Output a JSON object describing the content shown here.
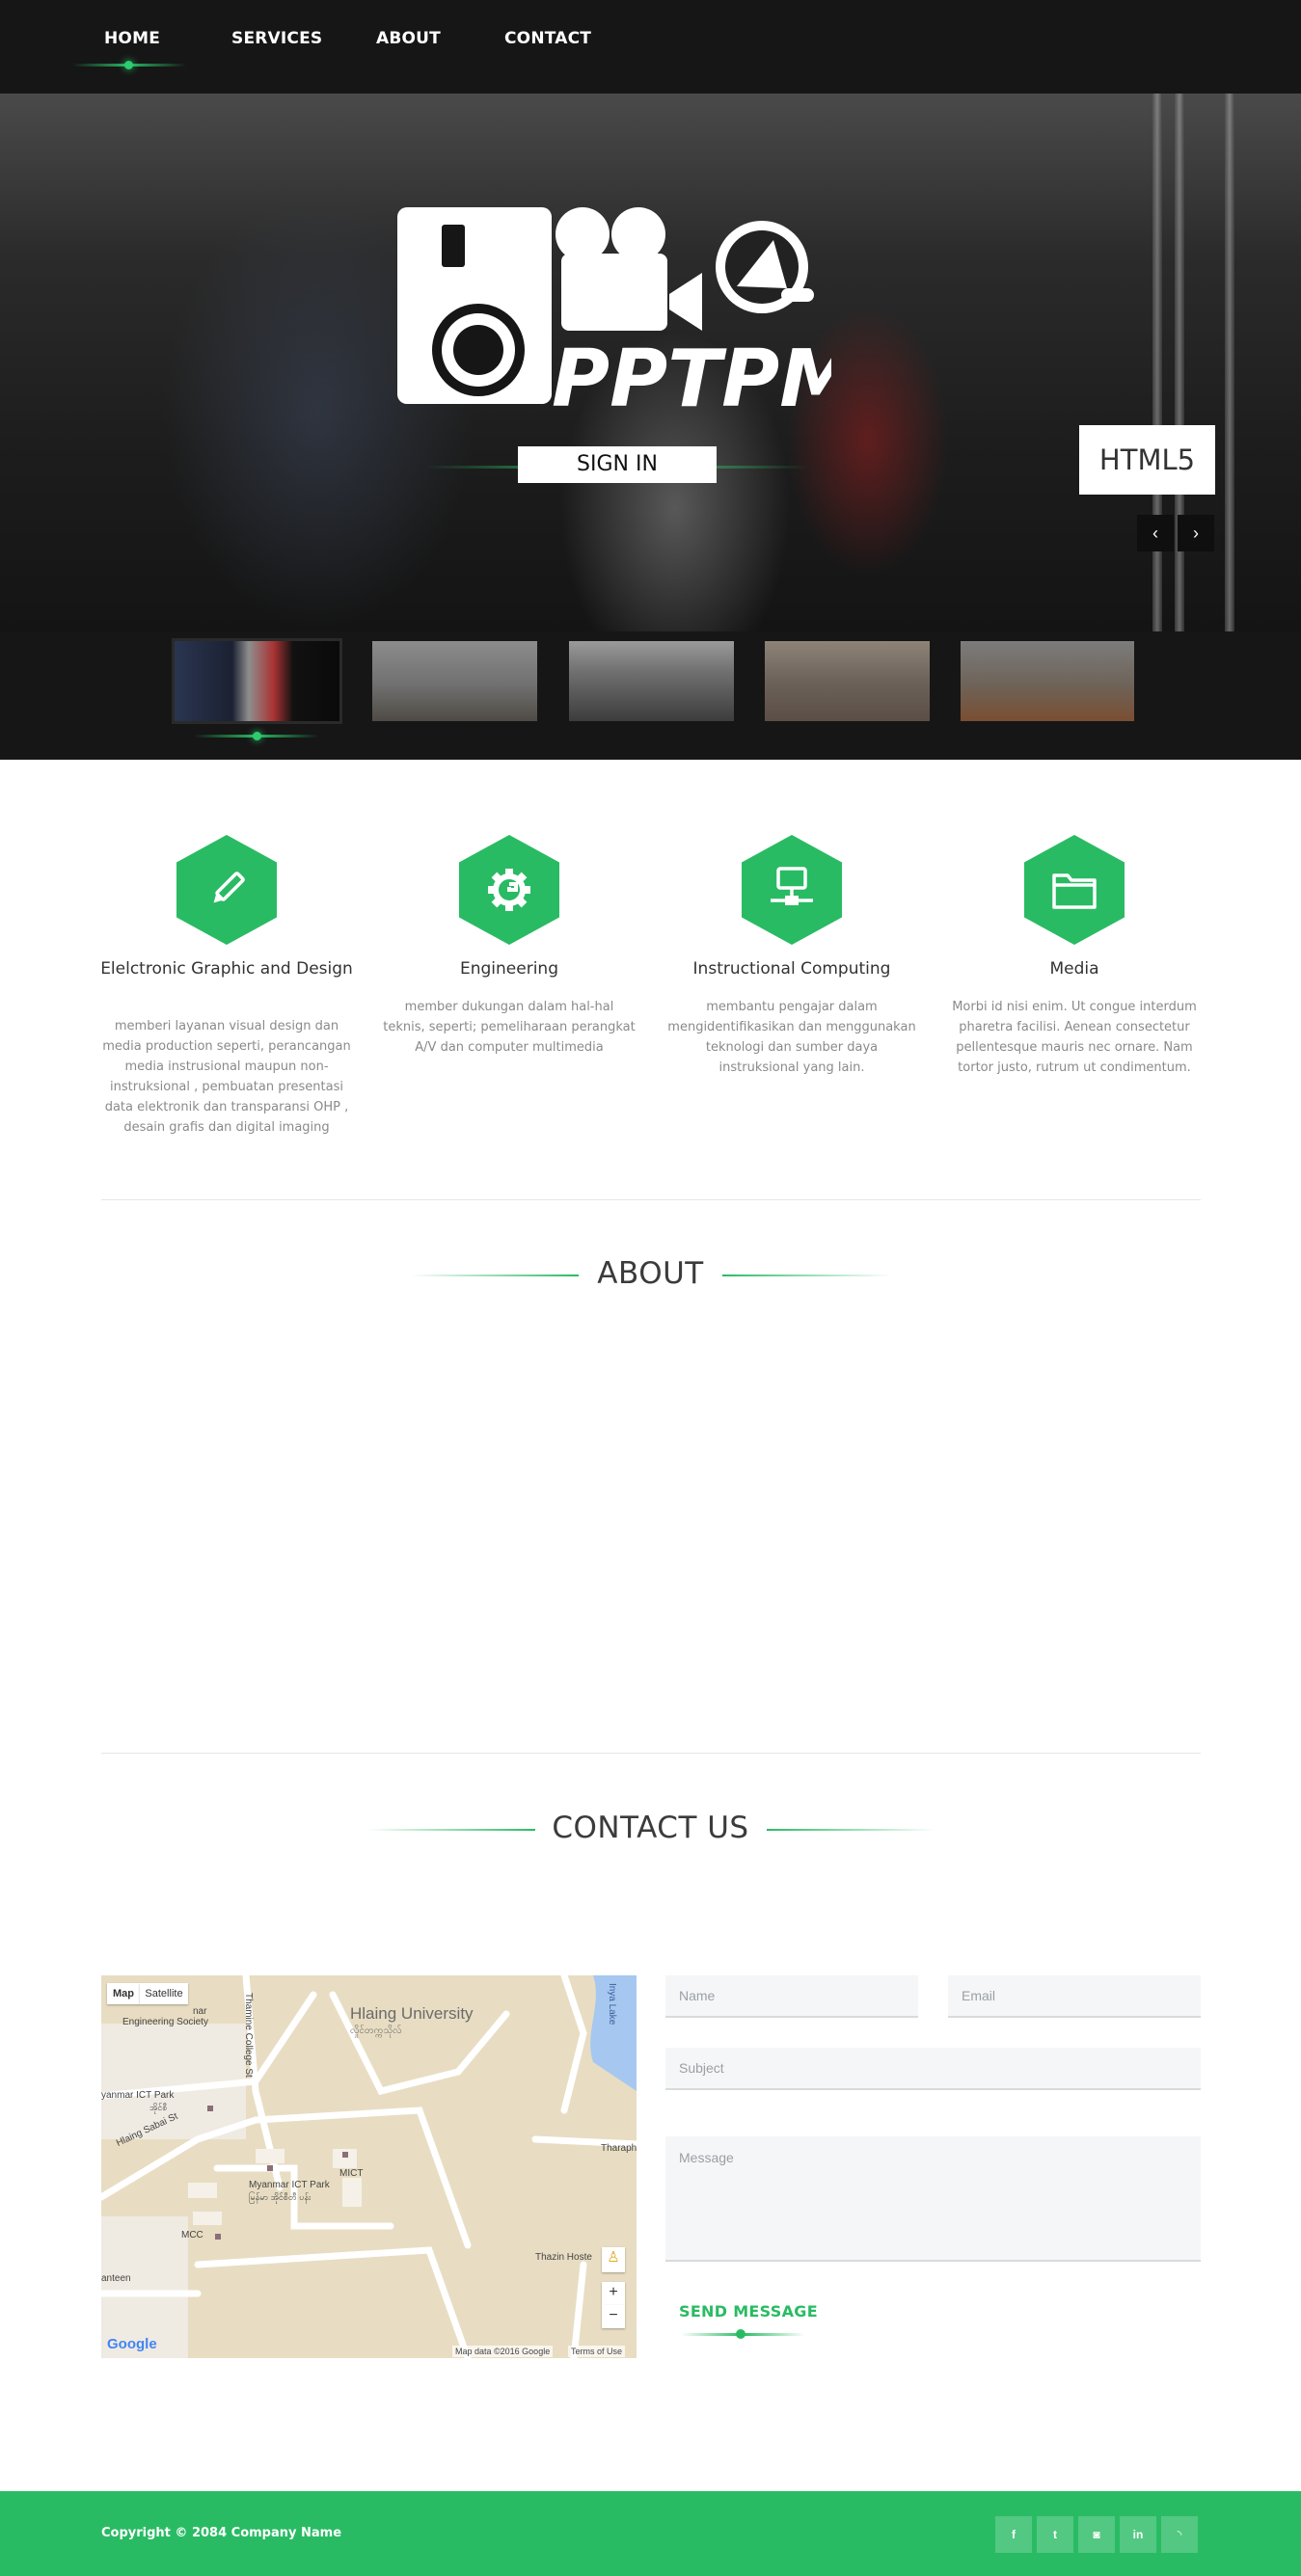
{
  "nav": {
    "items": [
      {
        "label": "HOME",
        "active": true
      },
      {
        "label": "SERVICES"
      },
      {
        "label": "ABOUT"
      },
      {
        "label": "CONTACT"
      }
    ],
    "accent": "#29bb63"
  },
  "hero": {
    "logo_text": "PPTPM",
    "sign_in_label": "SIGN IN",
    "badge_text": "HTML5",
    "prev_icon": "chevron-left-icon",
    "next_icon": "chevron-right-icon"
  },
  "services": [
    {
      "icon": "pencil-icon",
      "title": "Elelctronic Graphic and Design",
      "desc": "memberi layanan visual design dan media production seperti, perancangan media instrusional maupun non-instruksional , pembuatan presentasi data elektronik dan transparansi OHP , desain grafis dan digital imaging"
    },
    {
      "icon": "gear-icon",
      "title": "Engineering",
      "desc": "member dukungan dalam hal-hal teknis, seperti; pemeliharaan perangkat A/V dan computer multimedia"
    },
    {
      "icon": "network-icon",
      "title": "Instructional Computing",
      "desc": "membantu pengajar dalam mengidentifikasikan dan menggunakan teknologi dan sumber daya instruksional yang lain."
    },
    {
      "icon": "folder-icon",
      "title": "Media",
      "desc": "Morbi id nisi enim. Ut congue interdum pharetra facilisi. Aenean consectetur pellentesque mauris nec ornare. Nam tortor justo, rutrum ut condimentum."
    }
  ],
  "about": {
    "title": "ABOUT"
  },
  "contact": {
    "title": "CONTACT US",
    "map": {
      "map_label": "Map",
      "satellite_label": "Satellite",
      "place_university": "Hlaing University",
      "place_university_local": "လှိုင်တက္ကသိုလ်",
      "place_ict_park": "Myanmar ICT Park",
      "place_ict_park_local": "မြန်မာ အိုင်စီတီ ပန်း",
      "place_mict": "MICT",
      "place_mcc": "MCC",
      "place_eng_society": "Engineering Society",
      "place_nar": "nar",
      "place_ict_park_left": "yanmar ICT Park",
      "place_ict_park_left_local": "အိုင်စီ",
      "street_thamine": "Thamine College St",
      "street_sabai": "Hlaing Sabai St",
      "place_inya": "Inya Lake",
      "place_tharaphu": "Tharaph",
      "place_thazin": "Thazin Hoste",
      "place_canteen": "anteen",
      "zoom_in": "+",
      "zoom_out": "−",
      "attribution": "Map data ©2016 Google",
      "terms": "Terms of Use",
      "google": "Google"
    },
    "form": {
      "name_placeholder": "Name",
      "email_placeholder": "Email",
      "subject_placeholder": "Subject",
      "message_placeholder": "Message",
      "send_label": "SEND MESSAGE"
    }
  },
  "footer": {
    "copyright": "Copyright © 2084 Company Name",
    "social": [
      {
        "icon": "facebook-icon",
        "glyph": "f"
      },
      {
        "icon": "twitter-icon",
        "glyph": "t"
      },
      {
        "icon": "instagram-icon",
        "glyph": "◙"
      },
      {
        "icon": "linkedin-icon",
        "glyph": "in"
      },
      {
        "icon": "rss-icon",
        "glyph": "◝"
      }
    ]
  }
}
